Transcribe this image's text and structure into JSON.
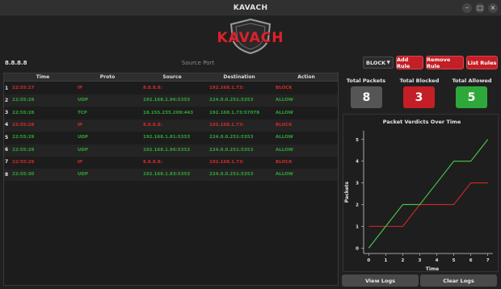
{
  "window": {
    "title": "KAVACH"
  },
  "logo": {
    "text": "KAVACH"
  },
  "rule_form": {
    "ip_value": "8.8.8.8",
    "port_placeholder": "Source Port",
    "action_selected": "BLOCK",
    "add_label": "Add Rule",
    "remove_label": "Remove Rule",
    "list_label": "List Rules"
  },
  "table": {
    "headers": [
      "Time",
      "Proto",
      "Source",
      "Destination",
      "Action"
    ],
    "rows": [
      {
        "num": "1",
        "time": "22:55:27",
        "proto": "IP",
        "source": "8.8.8.8:",
        "destination": "192.168.1.73:",
        "action": "BLOCK",
        "status": "block"
      },
      {
        "num": "2",
        "time": "22:55:28",
        "proto": "UDP",
        "source": "192.168.1.96:5353",
        "destination": "224.0.0.251:5353",
        "action": "ALLOW",
        "status": "allow"
      },
      {
        "num": "3",
        "time": "22:55:28",
        "proto": "TCP",
        "source": "18.155.235.209:443",
        "destination": "192.168.1.73:57078",
        "action": "ALLOW",
        "status": "allow"
      },
      {
        "num": "4",
        "time": "22:55:28",
        "proto": "IP",
        "source": "8.8.8.8:",
        "destination": "192.168.1.73:",
        "action": "BLOCK",
        "status": "block"
      },
      {
        "num": "5",
        "time": "22:55:29",
        "proto": "UDP",
        "source": "192.168.1.81:5353",
        "destination": "224.0.0.251:5353",
        "action": "ALLOW",
        "status": "allow"
      },
      {
        "num": "6",
        "time": "22:55:29",
        "proto": "UDP",
        "source": "192.168.1.96:5353",
        "destination": "224.0.0.251:5353",
        "action": "ALLOW",
        "status": "allow"
      },
      {
        "num": "7",
        "time": "22:55:29",
        "proto": "IP",
        "source": "8.8.8.8:",
        "destination": "192.168.1.73:",
        "action": "BLOCK",
        "status": "block"
      },
      {
        "num": "8",
        "time": "22:55:30",
        "proto": "UDP",
        "source": "192.168.1.83:5353",
        "destination": "224.0.0.251:5353",
        "action": "ALLOW",
        "status": "allow"
      }
    ]
  },
  "stats": {
    "total_packets_label": "Total Packets",
    "total_packets": "8",
    "total_blocked_label": "Total Blocked",
    "total_blocked": "3",
    "total_allowed_label": "Total Allowed",
    "total_allowed": "5"
  },
  "colors": {
    "block": "#d22a2a",
    "allow": "#2fa335",
    "accent_red": "#c41e26",
    "packets_box": "#555555",
    "allowed_box": "#2ea83a"
  },
  "chart_data": {
    "type": "line",
    "title": "Packet Verdicts Over Time",
    "xlabel": "Time",
    "ylabel": "Packets",
    "x": [
      0,
      1,
      2,
      3,
      4,
      5,
      6,
      7
    ],
    "xlim": [
      -0.3,
      7.3
    ],
    "ylim": [
      -0.25,
      5.4
    ],
    "xticks": [
      "0",
      "1",
      "2",
      "3",
      "4",
      "5",
      "6",
      "7"
    ],
    "yticks": [
      "0",
      "1",
      "2",
      "3",
      "4",
      "5"
    ],
    "grid": false,
    "legend": "none",
    "series": [
      {
        "values": [
          1,
          1,
          1,
          2,
          2,
          2,
          3,
          3
        ],
        "color": "#d22a2a"
      },
      {
        "values": [
          0,
          1,
          2,
          2,
          3,
          4,
          4,
          5
        ],
        "color": "#4cc94c"
      }
    ]
  },
  "footer": {
    "view_logs_label": "View Logs",
    "clear_logs_label": "Clear Logs"
  }
}
